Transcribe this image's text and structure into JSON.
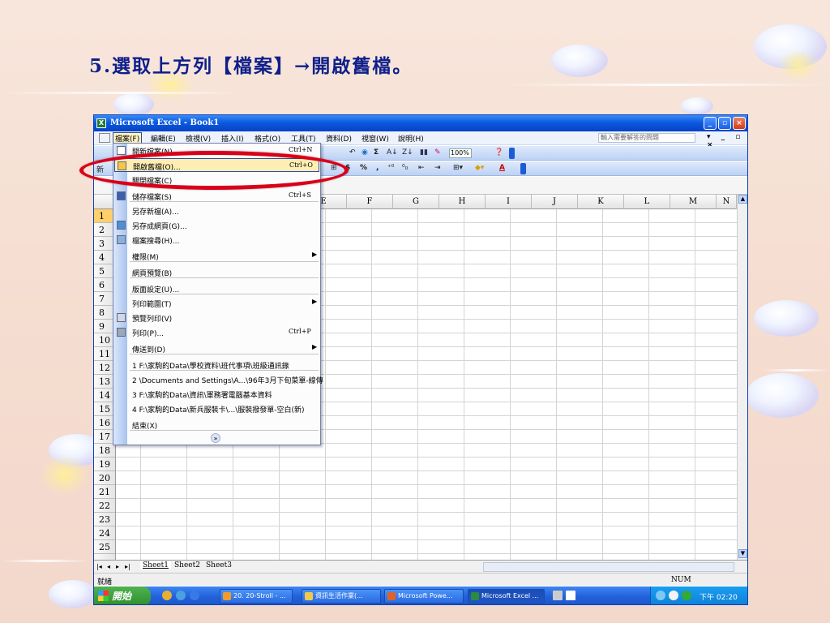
{
  "slide": {
    "title": "5.選取上方列【檔案】→開啟舊檔。"
  },
  "window": {
    "title": "Microsoft Excel - Book1",
    "min_label": "_",
    "max_label": "▫",
    "close_label": "×"
  },
  "menubar": {
    "items": [
      "檔案(F)",
      "編輯(E)",
      "檢視(V)",
      "插入(I)",
      "格式(O)",
      "工具(T)",
      "資料(D)",
      "視窗(W)",
      "說明(H)"
    ],
    "help_placeholder": "輸入需要解答的問題",
    "mdi_controls": "▾ _ ▫ ×"
  },
  "toolbar": {
    "new_label": "新",
    "sum": "Σ",
    "zoom": "100%",
    "percent": "%",
    "comma": ",",
    "font_color_label": "A"
  },
  "file_menu": {
    "items": [
      {
        "label": "開新檔案(N)...",
        "shortcut": "Ctrl+N",
        "icon": "new-file-icon"
      },
      {
        "label": "開啟舊檔(O)...",
        "shortcut": "Ctrl+O",
        "icon": "open-folder-icon"
      },
      {
        "label": "關閉檔案(C)",
        "shortcut": "",
        "icon": ""
      },
      {
        "label": "儲存檔案(S)",
        "shortcut": "Ctrl+S",
        "icon": "save-icon"
      },
      {
        "label": "另存新檔(A)...",
        "shortcut": "",
        "icon": ""
      },
      {
        "label": "另存成網頁(G)...",
        "shortcut": "",
        "icon": "web-page-icon"
      },
      {
        "label": "檔案搜尋(H)...",
        "shortcut": "",
        "icon": "file-search-icon"
      },
      {
        "label": "權限(M)",
        "shortcut": "",
        "icon": "",
        "submenu": true
      },
      {
        "label": "網頁預覽(B)",
        "shortcut": "",
        "icon": ""
      },
      {
        "label": "版面設定(U)...",
        "shortcut": "",
        "icon": ""
      },
      {
        "label": "列印範圍(T)",
        "shortcut": "",
        "icon": "",
        "submenu": true
      },
      {
        "label": "預覽列印(V)",
        "shortcut": "",
        "icon": "print-preview-icon"
      },
      {
        "label": "列印(P)...",
        "shortcut": "Ctrl+P",
        "icon": "print-icon"
      },
      {
        "label": "傳送到(D)",
        "shortcut": "",
        "icon": "",
        "submenu": true
      },
      {
        "label": "1 F:\\家駒的Data\\學校資料\\班代事項\\班級通訊錄",
        "shortcut": "",
        "icon": ""
      },
      {
        "label": "2 \\Documents and Settings\\A...\\96年3月下旬菜單-線傳",
        "shortcut": "",
        "icon": ""
      },
      {
        "label": "3 F:\\家駒的Data\\資訊\\軍務署電腦基本資料",
        "shortcut": "",
        "icon": ""
      },
      {
        "label": "4 F:\\家駒的Data\\新兵服裝卡\\...\\服裝撥發單-空白(新)",
        "shortcut": "",
        "icon": ""
      },
      {
        "label": "結束(X)",
        "shortcut": "",
        "icon": ""
      }
    ],
    "more_glyph": "»"
  },
  "grid": {
    "columns": [
      "E",
      "F",
      "G",
      "H",
      "I",
      "J",
      "K",
      "L",
      "M",
      "N"
    ],
    "rows": [
      "1",
      "2",
      "3",
      "4",
      "5",
      "6",
      "7",
      "8",
      "9",
      "10",
      "11",
      "12",
      "13",
      "14",
      "15",
      "16",
      "17",
      "18",
      "19",
      "20",
      "21",
      "22",
      "23",
      "24",
      "25"
    ],
    "selected_row": "1"
  },
  "sheets": {
    "nav": [
      "|◂",
      "◂",
      "▸",
      "▸|"
    ],
    "tabs": [
      "Sheet1",
      "Sheet2",
      "Sheet3"
    ],
    "active": "Sheet1"
  },
  "status": {
    "ready": "就緒",
    "num": "NUM"
  },
  "taskbar": {
    "start_label": "開始",
    "tasks": [
      "20. 20-Stroll - ...",
      "資訊生活作業(...",
      "Microsoft Powe...",
      "Microsoft Excel ..."
    ],
    "active_task": "Microsoft Excel ...",
    "clock": "下午 02:20"
  },
  "colors": {
    "title_text": "#0e1f8a",
    "callout": "#d8001a",
    "xp_blue": "#0b5ae0"
  }
}
